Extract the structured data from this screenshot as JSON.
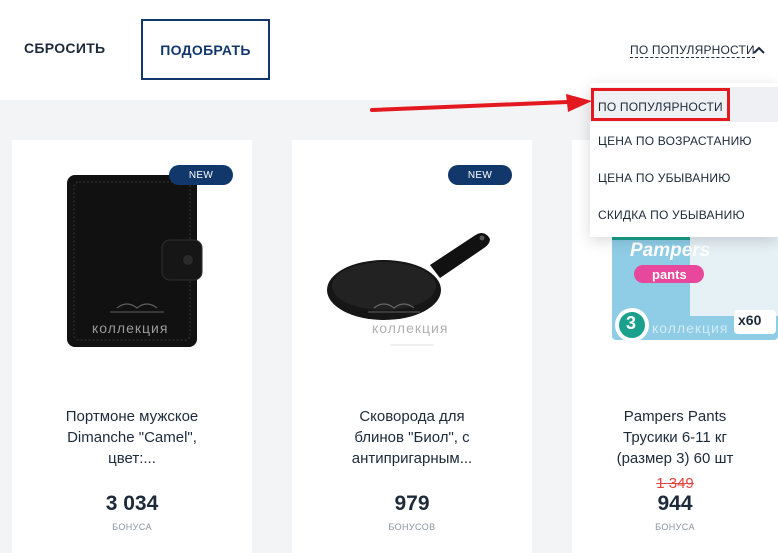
{
  "toolbar": {
    "reset_label": "СБРОСИТЬ",
    "select_label": "ПОДОБРАТЬ",
    "sort_label": "ПО ПОПУЛЯРНОСТИ"
  },
  "sort_dropdown": {
    "options": [
      "ПО ПОПУЛЯРНОСТИ",
      "ЦЕНА ПО ВОЗРАСТАНИЮ",
      "ЦЕНА ПО УБЫВАНИЮ",
      "СКИДКА ПО УБЫВАНИЮ"
    ],
    "selected": "ПО ПОПУЛЯРНОСТИ"
  },
  "products": [
    {
      "badge": "NEW",
      "watermark": "коллекция",
      "name_lines": [
        "Портмоне мужское",
        "Dimanche \"Camel\",",
        "цвет:..."
      ],
      "price": "3 034",
      "unit": "БОНУСА"
    },
    {
      "badge": "NEW",
      "watermark": "коллекция",
      "name_lines": [
        "Сковорода для",
        "блинов \"Биол\", с",
        "антипригарным..."
      ],
      "price": "979",
      "unit": "БОНУСОВ"
    },
    {
      "badge": "",
      "watermark": "коллекция",
      "brand_text": "Pampers",
      "sub_text": "pants",
      "size_text": "3",
      "count_text": "x60",
      "name_lines": [
        "Pampers Pants",
        "Трусики 6-11 кг",
        "(размер 3) 60 шт"
      ],
      "old_price": "1 349",
      "price": "944",
      "unit": "БОНУСА"
    }
  ],
  "colors": {
    "accent": "#12386b",
    "highlight": "#e3191f",
    "old_price": "#e4463e"
  },
  "icons": {
    "sort_toggle": "chevron-up-icon",
    "annotation": "red-arrow-icon"
  }
}
